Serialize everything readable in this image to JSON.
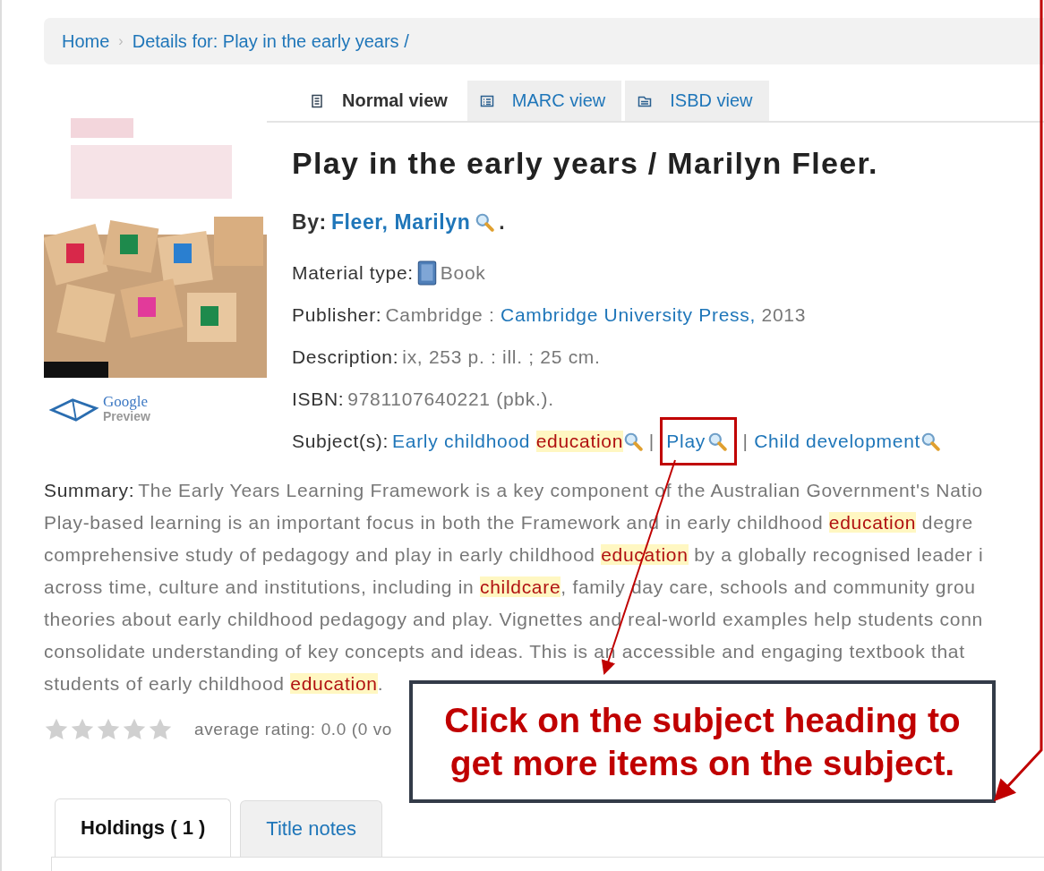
{
  "breadcrumb": {
    "separator": "›",
    "items": [
      {
        "label": "Home"
      },
      {
        "label": "Details for: Play in the early years /"
      }
    ]
  },
  "view_tabs": [
    {
      "label": "Normal view",
      "kind": "normal",
      "selected": true
    },
    {
      "label": "MARC view",
      "kind": "marc",
      "selected": false
    },
    {
      "label": "ISBD view",
      "kind": "isbd",
      "selected": false
    }
  ],
  "google_preview": {
    "brand": "Google",
    "caption": "Preview"
  },
  "title": "Play in the early years / Marilyn Fleer.",
  "author": {
    "label": "By:",
    "name": "Fleer, Marilyn",
    "end": "."
  },
  "fields": [
    {
      "label": "Material type:",
      "segments": [
        {
          "kind": "book"
        },
        {
          "kind": "text",
          "text": "Book"
        }
      ]
    },
    {
      "label": "Publisher:",
      "segments": [
        {
          "kind": "text",
          "text": "Cambridge : "
        },
        {
          "kind": "link",
          "text": "Cambridge University Press,"
        },
        {
          "kind": "text",
          "text": " 2013"
        }
      ]
    },
    {
      "label": "Description:",
      "segments": [
        {
          "kind": "text",
          "text": "ix, 253 p. : ill. ; 25 cm."
        }
      ]
    },
    {
      "label": "ISBN:",
      "segments": [
        {
          "kind": "text",
          "text": "9781107640221 (pbk.)."
        }
      ]
    },
    {
      "label": "Subject(s):",
      "segments": [
        {
          "kind": "link",
          "text": "Early childhood "
        },
        {
          "kind": "link",
          "text": "education",
          "highlight": true
        },
        {
          "kind": "search"
        },
        {
          "kind": "text",
          "text": " | "
        },
        {
          "kind": "link",
          "text": "Play",
          "framed": true
        },
        {
          "kind": "text",
          "text": " | "
        },
        {
          "kind": "link",
          "text": "Child development"
        },
        {
          "kind": "search"
        }
      ]
    }
  ],
  "summary": {
    "label": "Summary:",
    "lines": [
      [
        {
          "text": "The Early Years Learning Framework is a key component of the Australian Government's Natio",
          "highlight": false
        }
      ],
      [
        {
          "text": "Play-based learning is an important focus in both the Framework and in early childhood ",
          "highlight": false
        },
        {
          "text": "education",
          "highlight": true
        },
        {
          "text": " degre",
          "highlight": false
        }
      ],
      [
        {
          "text": "comprehensive study of pedagogy and play in early childhood ",
          "highlight": false
        },
        {
          "text": "education",
          "highlight": true
        },
        {
          "text": " by a globally recognised leader i",
          "highlight": false
        }
      ],
      [
        {
          "text": "across time, culture and institutions, including in ",
          "highlight": false
        },
        {
          "text": "childcare",
          "highlight": true
        },
        {
          "text": ", family day care, schools and community grou",
          "highlight": false
        }
      ],
      [
        {
          "text": "theories about early childhood pedagogy and play. Vignettes and real-world examples help students conn",
          "highlight": false
        }
      ],
      [
        {
          "text": "consolidate understanding of key concepts and ideas. This is an accessible and engaging textbook that",
          "highlight": false
        }
      ],
      [
        {
          "text": "students of early childhood ",
          "highlight": false
        },
        {
          "text": "education",
          "highlight": true
        },
        {
          "text": ".",
          "highlight": false
        }
      ]
    ]
  },
  "rating": {
    "stars": 0,
    "text": "average rating: 0.0 (0 vo"
  },
  "bottom_tabs": [
    {
      "label": "Holdings ( 1 )",
      "selected": true
    },
    {
      "label": "Title notes",
      "selected": false
    }
  ],
  "callout": {
    "lines": [
      "Click on the subject heading to",
      "get more items on the subject."
    ]
  }
}
